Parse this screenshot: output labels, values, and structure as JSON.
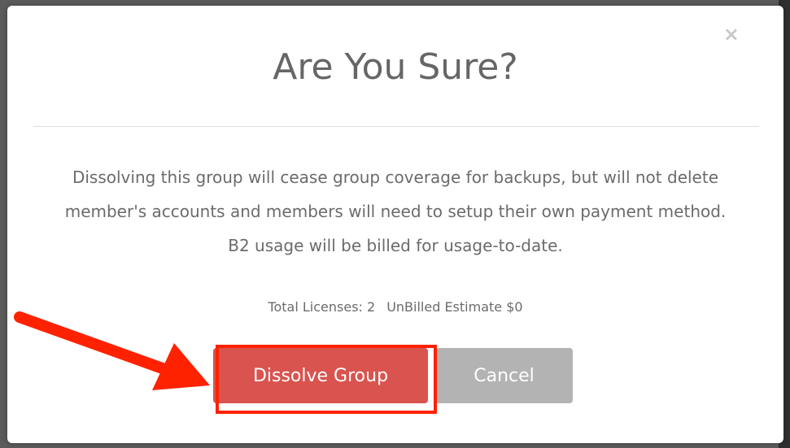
{
  "dialog": {
    "title": "Are You Sure?",
    "close_label": "×",
    "message": "Dissolving this group will cease group coverage for backups, but will not delete member's accounts and members will need to setup their own payment method. B2 usage will be billed for usage-to-date.",
    "total_licenses": "Total Licenses: 2",
    "unbilled_estimate": "UnBilled Estimate $0"
  },
  "buttons": {
    "dissolve_label": "Dissolve Group",
    "cancel_label": "Cancel"
  },
  "colors": {
    "dissolve_button": "#d9534f",
    "cancel_button": "#b3b3b3",
    "highlight": "#ff2200",
    "arrow": "#ff2200"
  },
  "icons": {
    "close": "close-icon",
    "annotation_arrow": "arrow-right-icon"
  }
}
